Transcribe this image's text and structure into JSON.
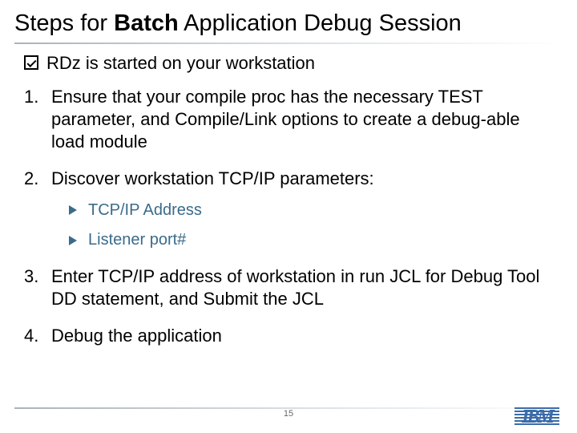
{
  "title": {
    "pre": "Steps for ",
    "bold": "Batch",
    "post": " Application Debug Session"
  },
  "prereq": "RDz is started on your workstation",
  "steps": [
    {
      "text": "Ensure that your compile proc has the necessary TEST parameter, and Compile/Link options to create a debug-able load module"
    },
    {
      "text": "Discover workstation TCP/IP parameters:",
      "subs": [
        "TCP/IP Address",
        "Listener port#"
      ]
    },
    {
      "text": "Enter TCP/IP address of workstation in run JCL for Debug Tool DD statement, and Submit the JCL"
    },
    {
      "text": "Debug the application"
    }
  ],
  "page_number": "15",
  "logo_text": "IBM"
}
